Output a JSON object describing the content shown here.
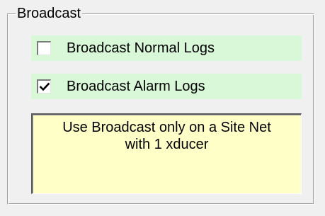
{
  "group": {
    "title": "Broadcast"
  },
  "options": [
    {
      "label": "Broadcast Normal Logs",
      "checked": false
    },
    {
      "label": "Broadcast Alarm Logs",
      "checked": true
    }
  ],
  "notice": {
    "line1": "Use Broadcast only on a Site Net",
    "line2": "with 1 xducer"
  },
  "colors": {
    "option_background": "#d8f8d8",
    "notice_background": "#ffffc8",
    "window_background": "#f0f0f0"
  },
  "icons": {
    "checked": "checkmark-icon"
  }
}
